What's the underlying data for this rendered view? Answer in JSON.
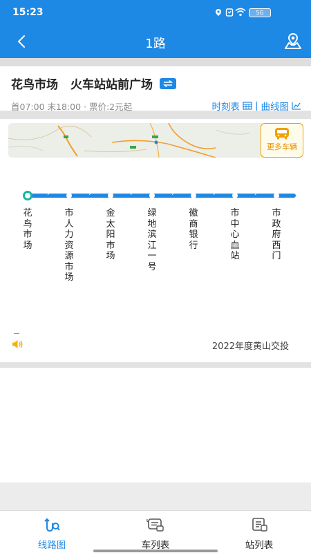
{
  "status": {
    "time": "15:23",
    "battery": "5G"
  },
  "nav": {
    "title": "1路"
  },
  "route": {
    "from": "花鸟市场",
    "to": "火车站站前广场",
    "schedule": "首07:00 末18:00 · 票价:2元起",
    "timetable_link": "时刻表",
    "divider": "|",
    "curve_link": "曲线图"
  },
  "map": {
    "more_vehicles": "更多车辆"
  },
  "stops": [
    "花鸟市场",
    "市人力资源市场",
    "金太阳市场",
    "绿地滨江一号",
    "徽商银行",
    "市中心血站",
    "市政府西门"
  ],
  "notice": {
    "text": "2022年度黄山交投"
  },
  "tabs": [
    {
      "label": "线路图",
      "icon": "route-map-icon",
      "active": true
    },
    {
      "label": "车列表",
      "icon": "bus-list-icon",
      "active": false
    },
    {
      "label": "站列表",
      "icon": "station-list-icon",
      "active": false
    }
  ],
  "colors": {
    "primary": "#1e88e5",
    "accent": "#e58e00",
    "start": "#19b5a5"
  }
}
